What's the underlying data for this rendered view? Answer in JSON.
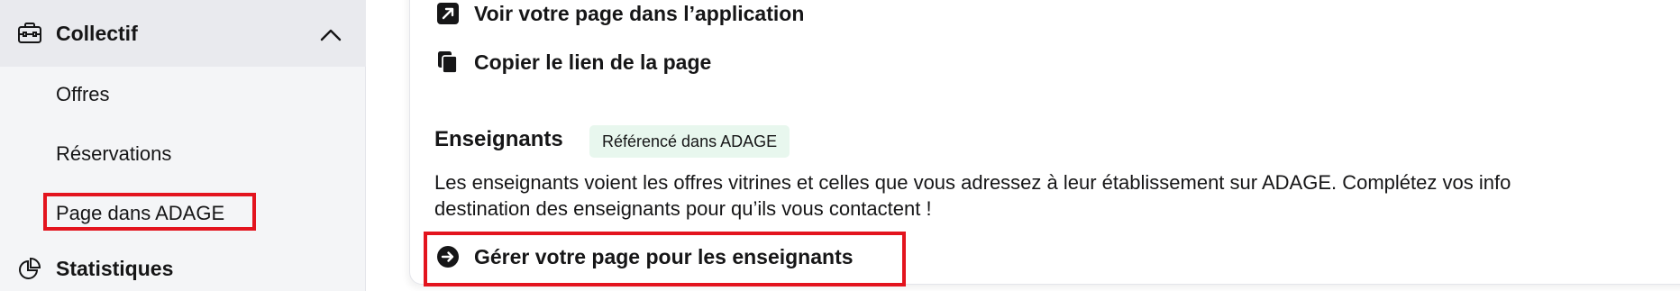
{
  "sidebar": {
    "collectif": {
      "label": "Collectif",
      "icon": "briefcase-icon",
      "expanded": true
    },
    "items": [
      {
        "label": "Offres"
      },
      {
        "label": "Réservations"
      },
      {
        "label": "Page dans ADAGE",
        "highlighted": true
      }
    ],
    "statistiques": {
      "label": "Statistiques",
      "icon": "pie-chart-icon"
    }
  },
  "main": {
    "actions": [
      {
        "label": "Voir votre page dans l’application",
        "icon": "external-link-icon"
      },
      {
        "label": "Copier le lien de la page",
        "icon": "copy-icon"
      }
    ],
    "enseignants": {
      "title": "Enseignants",
      "badge": "Référencé dans ADAGE",
      "description_line1": "Les enseignants voient les offres vitrines et celles que vous adressez à leur établissement sur ADAGE. Complétez vos info",
      "description_line2": "destination des enseignants pour qu’ils vous contactent !",
      "cta": {
        "label": "Gérer votre page pour les enseignants",
        "icon": "arrow-right-circle-icon"
      }
    }
  },
  "colors": {
    "highlight": "#e3141e",
    "badge_bg": "#e8f7ee",
    "sidebar_bg": "#f4f5f7"
  }
}
